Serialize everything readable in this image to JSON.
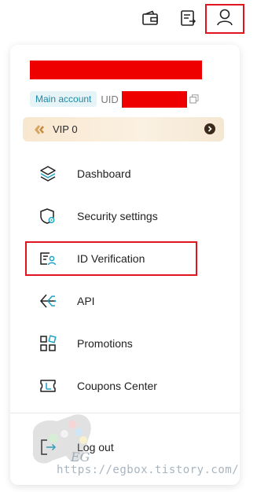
{
  "topbar": {
    "icons": [
      "wallet-icon",
      "orders-icon",
      "user-icon"
    ]
  },
  "account": {
    "badge": "Main account",
    "uid_label": "UID"
  },
  "vip": {
    "label": "VIP 0"
  },
  "menu": {
    "items": [
      {
        "label": "Dashboard",
        "icon": "layers-icon"
      },
      {
        "label": "Security settings",
        "icon": "shield-icon"
      },
      {
        "label": "ID Verification",
        "icon": "id-card-icon"
      },
      {
        "label": "API",
        "icon": "api-icon"
      },
      {
        "label": "Promotions",
        "icon": "grid-icon"
      },
      {
        "label": "Coupons Center",
        "icon": "coupon-icon"
      }
    ],
    "logout": "Log out"
  },
  "watermark": {
    "text": "https://egbox.tistory.com/",
    "logo_text": "EG"
  },
  "colors": {
    "accent": "#1d8aa8",
    "highlight": "#e0141e",
    "redaction": "#ee0000"
  }
}
